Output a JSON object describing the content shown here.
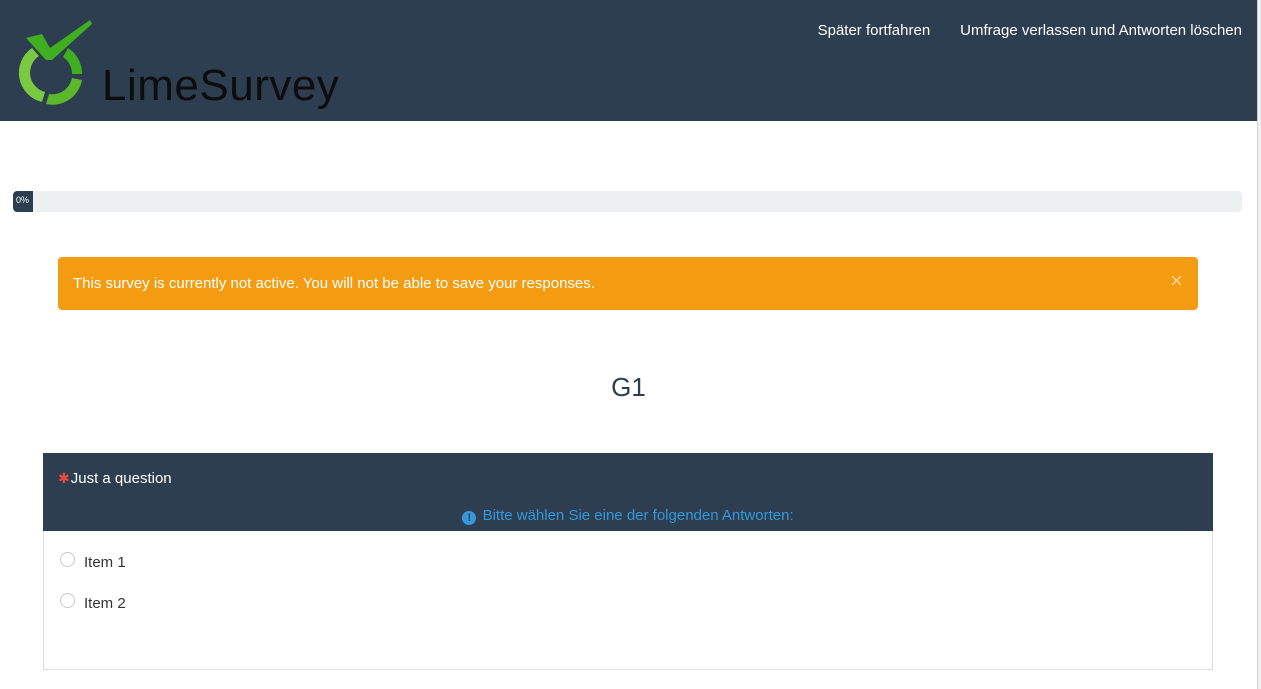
{
  "header": {
    "logo_text": "LimeSurvey",
    "links": [
      {
        "label": "Später fortfahren"
      },
      {
        "label": "Umfrage verlassen und Antworten löschen"
      }
    ],
    "background": "#2c3e50"
  },
  "progress": {
    "value_percent": 0,
    "label": "0%"
  },
  "alert": {
    "message": "This survey is currently not active. You will not be able to save your responses.",
    "close_symbol": "×",
    "color": "#f39c12"
  },
  "group": {
    "title": "G1"
  },
  "question": {
    "mandatory_mark": "✱",
    "text": "Just a question",
    "help_icon": "info-icon",
    "help_text": "Bitte wählen Sie eine der folgenden Antworten:",
    "answers": [
      {
        "label": "Item 1"
      },
      {
        "label": "Item 2"
      }
    ]
  }
}
